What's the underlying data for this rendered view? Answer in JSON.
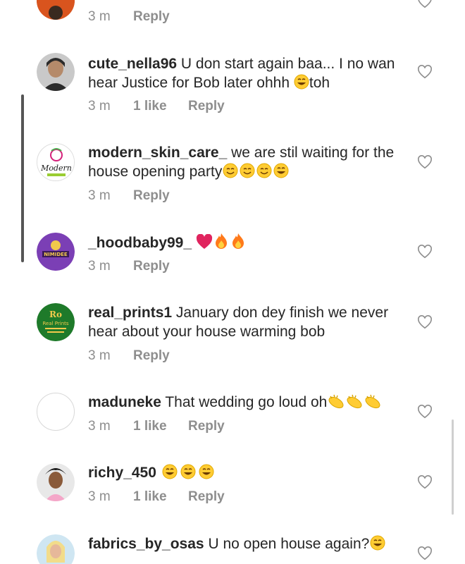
{
  "comments": [
    {
      "username": "",
      "text": "",
      "time": "3 m",
      "likes": "",
      "reply": "Reply",
      "emojis": []
    },
    {
      "username": "cute_nella96",
      "text": "U don start again baa... I no wan hear Justice for Bob later ohhh",
      "time": "3 m",
      "likes": "1 like",
      "reply": "Reply",
      "emojis": [
        "grin-sweat"
      ],
      "suffix": "toh"
    },
    {
      "username": "modern_skin_care_",
      "text": "we are stil waiting for the house opening party",
      "time": "3 m",
      "likes": "",
      "reply": "Reply",
      "emojis": [
        "smile",
        "smile",
        "smile",
        "grin-sweat"
      ]
    },
    {
      "username": "_hoodbaby99_",
      "text": "",
      "time": "3 m",
      "likes": "",
      "reply": "Reply",
      "emojis": [
        "heart",
        "fire",
        "fire"
      ]
    },
    {
      "username": "real_prints1",
      "text": "January don dey finish we never hear about your house warming bob",
      "time": "3 m",
      "likes": "",
      "reply": "Reply",
      "emojis": []
    },
    {
      "username": "maduneke",
      "text": "That wedding go loud oh",
      "time": "3 m",
      "likes": "1 like",
      "reply": "Reply",
      "emojis": [
        "clap",
        "clap",
        "clap"
      ]
    },
    {
      "username": "richy_450",
      "text": "",
      "time": "3 m",
      "likes": "1 like",
      "reply": "Reply",
      "emojis": [
        "grin-sweat",
        "grin-sweat",
        "grin-sweat"
      ]
    },
    {
      "username": "fabrics_by_osas",
      "text": "U no open house again?",
      "time": "",
      "likes": "",
      "reply": "",
      "emojis": [
        "grin-sweat"
      ]
    }
  ],
  "avatars": {
    "modern_logo_text": "Modern",
    "hood_logo_text": "NIMIDEE",
    "real_prints_logo_text": "Real Prints"
  },
  "colors": {
    "text": "#262626",
    "meta": "#8e8e8e",
    "heart_outline": "#8e8e8e",
    "red_heart": "#e0245e",
    "emoji_yellow": "#ffcc33",
    "avatar_purple": "#7b3fb5",
    "avatar_green": "#1e7a2a"
  }
}
